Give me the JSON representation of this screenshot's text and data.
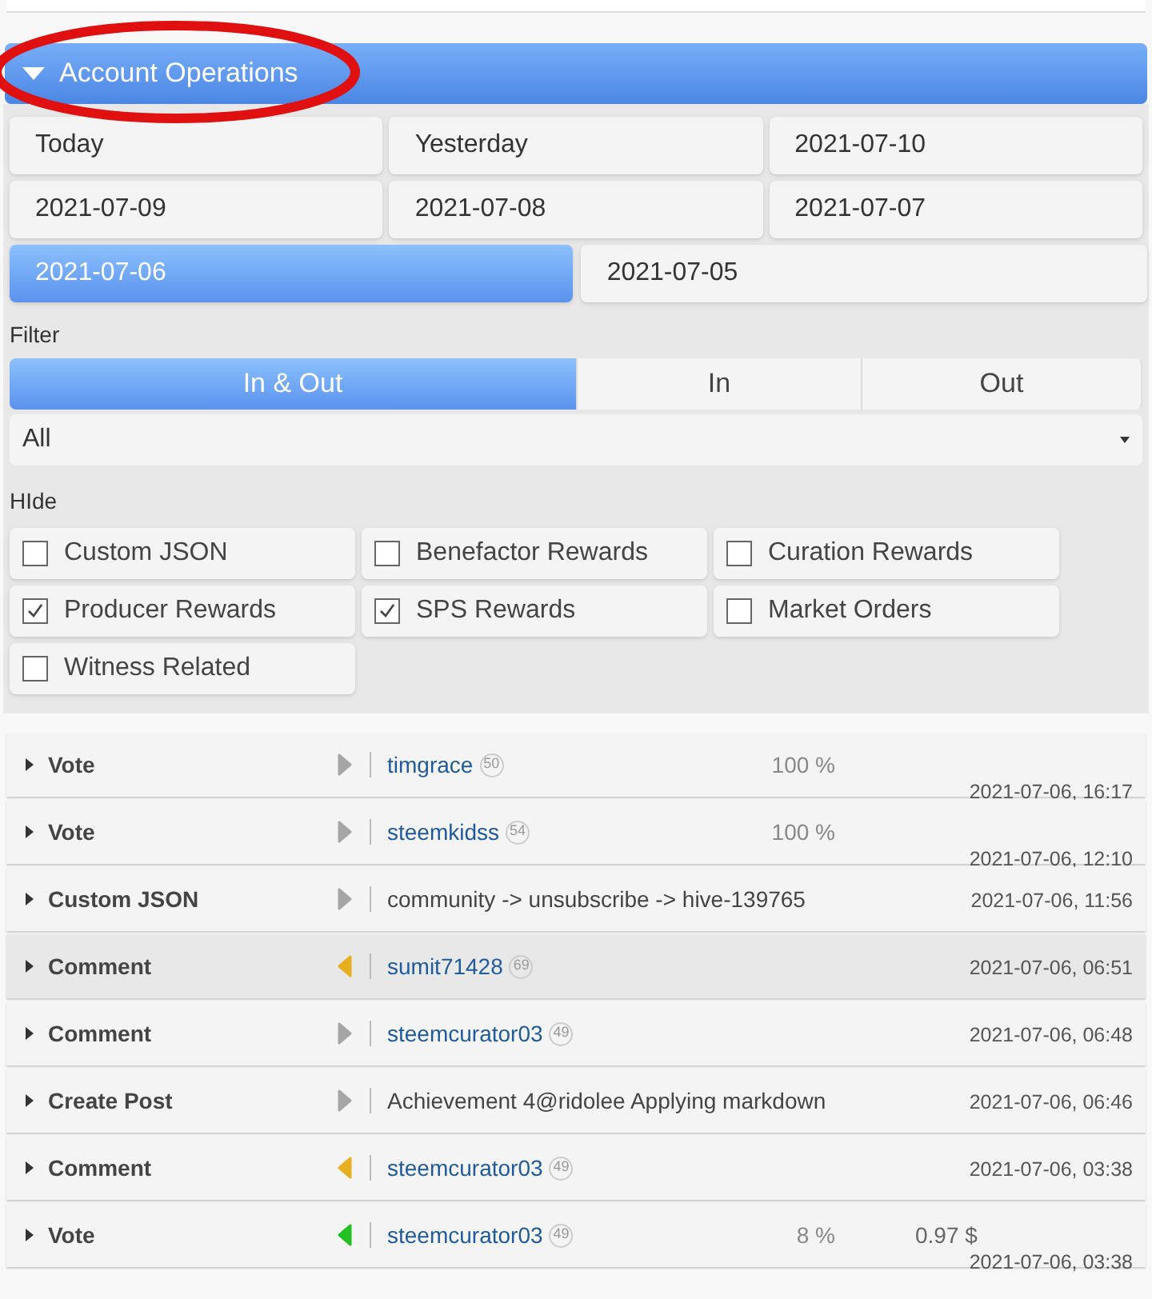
{
  "section": {
    "title": "Account Operations",
    "expanded": true
  },
  "dates": [
    {
      "label": "Today",
      "selected": false
    },
    {
      "label": "Yesterday",
      "selected": false
    },
    {
      "label": "2021-07-10",
      "selected": false
    },
    {
      "label": "2021-07-09",
      "selected": false
    },
    {
      "label": "2021-07-08",
      "selected": false
    },
    {
      "label": "2021-07-07",
      "selected": false
    },
    {
      "label": "2021-07-06",
      "selected": true
    },
    {
      "label": "2021-07-05",
      "selected": false
    }
  ],
  "filter": {
    "label": "Filter",
    "tabs": [
      {
        "label": "In & Out",
        "selected": true
      },
      {
        "label": "In",
        "selected": false
      },
      {
        "label": "Out",
        "selected": false
      }
    ],
    "dropdown": {
      "value": "All"
    }
  },
  "hide": {
    "label": "HIde",
    "options": [
      {
        "label": "Custom JSON",
        "checked": false
      },
      {
        "label": "Benefactor Rewards",
        "checked": false
      },
      {
        "label": "Curation Rewards",
        "checked": false
      },
      {
        "label": "Producer Rewards",
        "checked": true
      },
      {
        "label": "SPS Rewards",
        "checked": true
      },
      {
        "label": "Market Orders",
        "checked": false
      },
      {
        "label": "Witness Related",
        "checked": false
      }
    ]
  },
  "operations": [
    {
      "type": "Vote",
      "kind": "out",
      "color": "#a6a6a6",
      "account": "timgrace",
      "reputation": "50",
      "percent": "100 %",
      "date": "2021-07-06, 16:17",
      "highlighted": false
    },
    {
      "type": "Vote",
      "kind": "out",
      "color": "#a6a6a6",
      "account": "steemkidss",
      "reputation": "54",
      "percent": "100 %",
      "date": "2021-07-06, 12:10",
      "highlighted": false
    },
    {
      "type": "Custom JSON",
      "kind": "out",
      "color": "#a6a6a6",
      "text": "community -> unsubscribe -> hive-139765",
      "date": "2021-07-06, 11:56",
      "highlighted": false
    },
    {
      "type": "Comment",
      "kind": "in",
      "color": "#e8b020",
      "account": "sumit71428",
      "reputation": "69",
      "date": "2021-07-06, 06:51",
      "highlighted": true
    },
    {
      "type": "Comment",
      "kind": "out",
      "color": "#a6a6a6",
      "account": "steemcurator03",
      "reputation": "49",
      "date": "2021-07-06, 06:48",
      "highlighted": false
    },
    {
      "type": "Create Post",
      "kind": "out",
      "color": "#a6a6a6",
      "text": "Achievement 4@ridolee Applying markdown",
      "date": "2021-07-06, 06:46",
      "highlighted": false
    },
    {
      "type": "Comment",
      "kind": "in",
      "color": "#e8b020",
      "account": "steemcurator03",
      "reputation": "49",
      "date": "2021-07-06, 03:38",
      "highlighted": false
    },
    {
      "type": "Vote",
      "kind": "in",
      "color": "#22c022",
      "account": "steemcurator03",
      "reputation": "49",
      "percent": "8 %",
      "amount": "0.97 $",
      "date": "2021-07-06, 03:38",
      "highlighted": false
    }
  ]
}
